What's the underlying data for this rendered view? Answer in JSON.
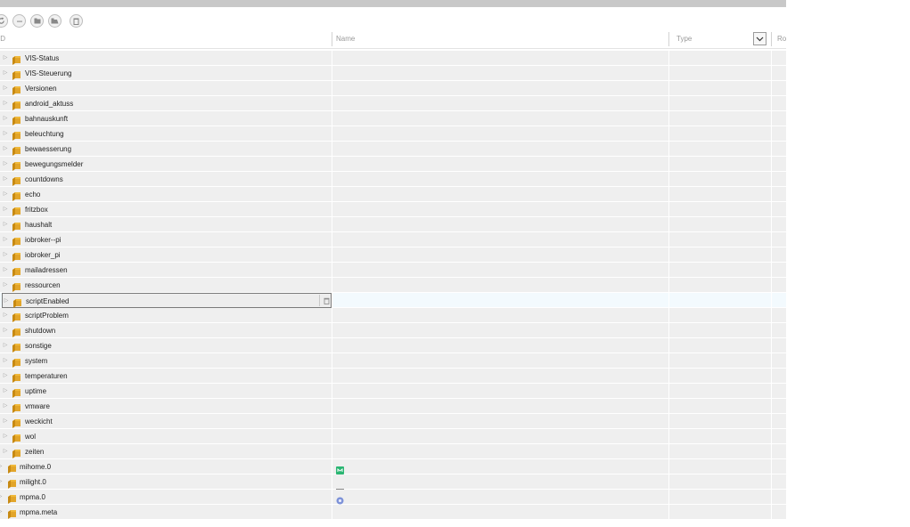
{
  "header": {
    "col_id": "ID",
    "col_name": "Name",
    "col_type": "Type",
    "col_role": "Rol"
  },
  "toolbar": {
    "buttons": [
      "refresh-icon",
      "minus-icon",
      "folder-icon",
      "folder-open-icon",
      "delete-icon"
    ]
  },
  "colors": {
    "folder": "#e2a52a",
    "selected_row": "#f3fafe",
    "row": "#efefef"
  },
  "rows": [
    {
      "label": "VIS-Status",
      "level": 2
    },
    {
      "label": "VIS-Steuerung",
      "level": 2
    },
    {
      "label": "Versionen",
      "level": 2
    },
    {
      "label": "android_aktuss",
      "level": 2
    },
    {
      "label": "bahnauskunft",
      "level": 2
    },
    {
      "label": "beleuchtung",
      "level": 2
    },
    {
      "label": "bewaesserung",
      "level": 2
    },
    {
      "label": "bewegungsmelder",
      "level": 2
    },
    {
      "label": "countdowns",
      "level": 2
    },
    {
      "label": "echo",
      "level": 2
    },
    {
      "label": "fritzbox",
      "level": 2
    },
    {
      "label": "haushalt",
      "level": 2
    },
    {
      "label": "iobroker--pi",
      "level": 2
    },
    {
      "label": "iobroker_pi",
      "level": 2
    },
    {
      "label": "mailadressen",
      "level": 2
    },
    {
      "label": "ressourcen",
      "level": 2
    },
    {
      "label": "scriptEnabled",
      "level": 2,
      "selected": true
    },
    {
      "label": "scriptProblem",
      "level": 2
    },
    {
      "label": "shutdown",
      "level": 2
    },
    {
      "label": "sonstige",
      "level": 2
    },
    {
      "label": "system",
      "level": 2
    },
    {
      "label": "temperaturen",
      "level": 2
    },
    {
      "label": "uptime",
      "level": 2
    },
    {
      "label": "vmware",
      "level": 2
    },
    {
      "label": "weckicht",
      "level": 2
    },
    {
      "label": "wol",
      "level": 2
    },
    {
      "label": "zeiten",
      "level": 2
    },
    {
      "label": "mihome.0",
      "level": 1,
      "name_icon": "mihome-icon"
    },
    {
      "label": "milight.0",
      "level": 1,
      "name_icon": "milight-icon"
    },
    {
      "label": "mpma.0",
      "level": 1,
      "name_icon": "mpma-icon"
    },
    {
      "label": "mpma.meta",
      "level": 1
    }
  ]
}
